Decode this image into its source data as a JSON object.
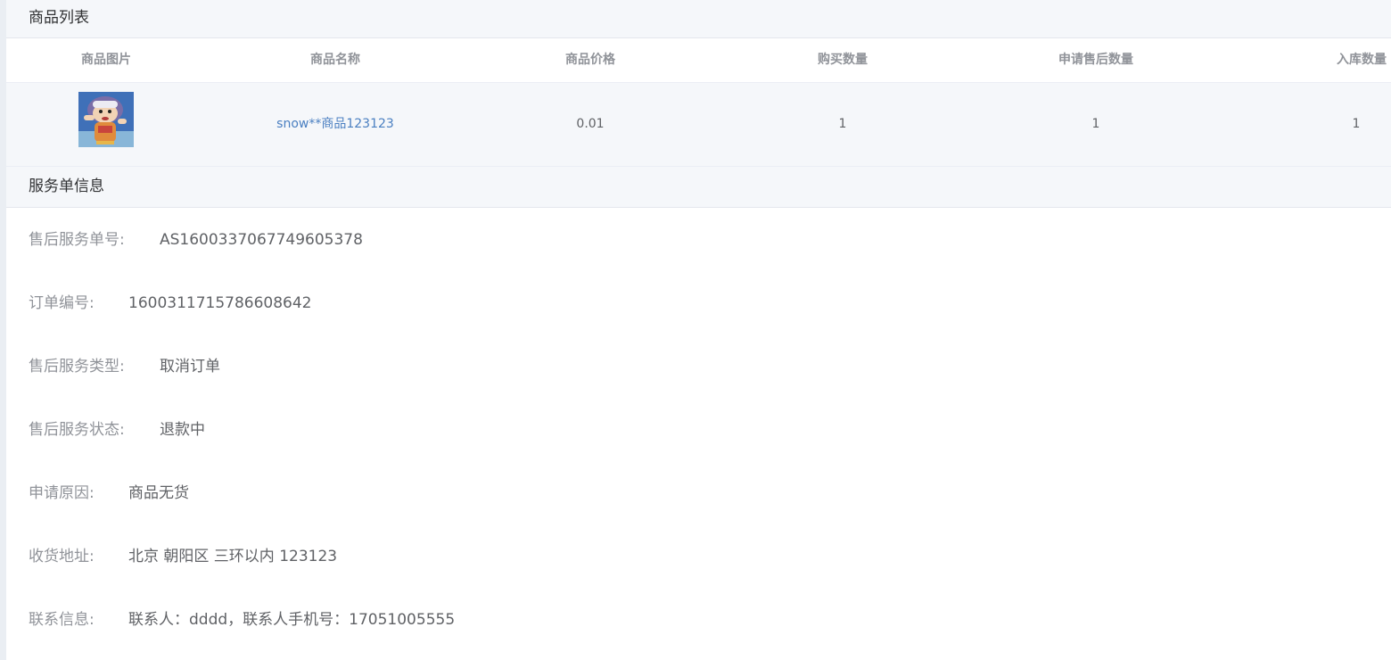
{
  "sections": {
    "products_title": "商品列表",
    "service_title": "服务单信息"
  },
  "table": {
    "headers": {
      "image": "商品图片",
      "name": "商品名称",
      "price": "商品价格",
      "buy_qty": "购买数量",
      "apply_qty": "申请售后数量",
      "stock_qty": "入库数量"
    },
    "rows": [
      {
        "image_icon": "product-thumbnail-cartoon",
        "name": "snow**商品123123",
        "price": "0.01",
        "buy_qty": "1",
        "apply_qty": "1",
        "stock_qty": "1"
      }
    ]
  },
  "service": {
    "after_sale_no": {
      "label": "售后服务单号:",
      "value": "AS1600337067749605378"
    },
    "order_no": {
      "label": "订单编号:",
      "value": "1600311715786608642"
    },
    "service_type": {
      "label": "售后服务类型:",
      "value": "取消订单"
    },
    "service_status": {
      "label": "售后服务状态:",
      "value": "退款中"
    },
    "reason": {
      "label": "申请原因:",
      "value": "商品无货"
    },
    "address": {
      "label": "收货地址:",
      "value": "北京 朝阳区 三环以内 123123"
    },
    "contact": {
      "label": "联系信息:",
      "value": "联系人：dddd，联系人手机号：17051005555"
    }
  },
  "colors": {
    "header_bg": "#f5f7fa",
    "link": "#4a7fc1",
    "label": "#909399",
    "value": "#606266"
  }
}
